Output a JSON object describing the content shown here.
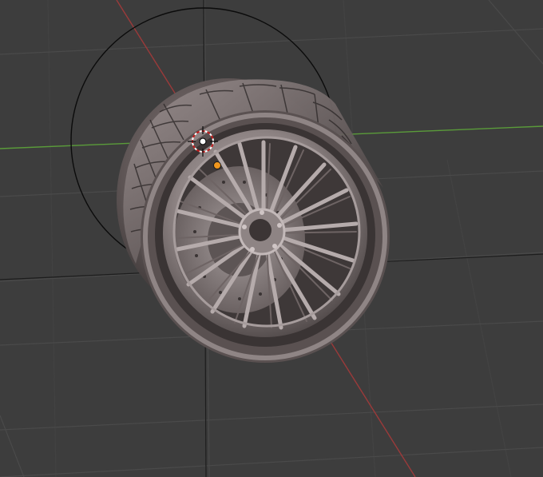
{
  "viewport": {
    "view": "3D Viewport",
    "object": "wheel-model",
    "background": "#3d3d3d",
    "grid_color": "#4a4a4a",
    "axis_x_color": "#9b3a3a",
    "axis_y_color": "#5a9b3a",
    "selection_dot_color": "#f0961e",
    "cursor_icon": "3d-cursor-icon",
    "show_grid": true,
    "show_axes": true
  }
}
